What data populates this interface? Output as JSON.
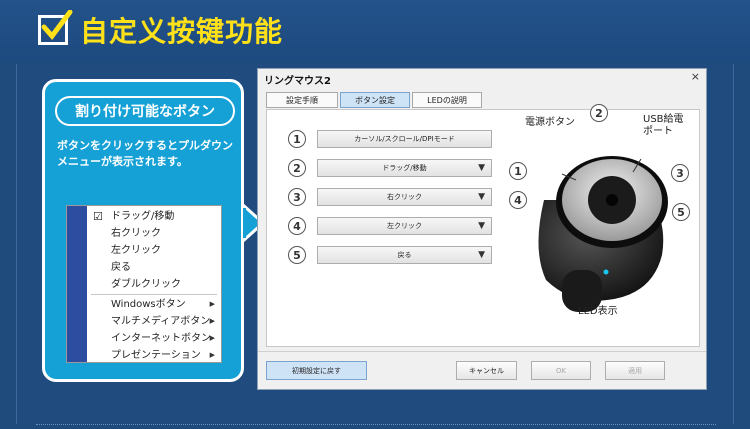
{
  "headline": {
    "title": "自定义按键功能"
  },
  "callout": {
    "pill": "割り付け可能なボタン",
    "description": "ボタンをクリックするとプルダウンメニューが表示されます。",
    "menu": {
      "items": [
        {
          "label": "ドラッグ/移動",
          "checked": true,
          "submenu": false
        },
        {
          "label": "右クリック",
          "checked": false,
          "submenu": false
        },
        {
          "label": "左クリック",
          "checked": false,
          "submenu": false
        },
        {
          "label": "戻る",
          "checked": false,
          "submenu": false
        },
        {
          "label": "ダブルクリック",
          "checked": false,
          "submenu": false
        },
        {
          "label": "Windowsボタン",
          "checked": false,
          "submenu": true
        },
        {
          "label": "マルチメディアボタン",
          "checked": false,
          "submenu": true
        },
        {
          "label": "インターネットボタン",
          "checked": false,
          "submenu": true
        },
        {
          "label": "プレゼンテーション",
          "checked": false,
          "submenu": true
        }
      ]
    }
  },
  "dialog": {
    "title": "リングマウス2",
    "close": "×",
    "tabs": [
      {
        "label": "設定手順",
        "active": false
      },
      {
        "label": "ボタン設定",
        "active": true
      },
      {
        "label": "LEDの説明",
        "active": false
      }
    ],
    "assignments": [
      {
        "num": "1",
        "label": "カーソル/スクロール/DPIモード",
        "dropdown": false
      },
      {
        "num": "2",
        "label": "ドラッグ/移動",
        "dropdown": true
      },
      {
        "num": "3",
        "label": "右クリック",
        "dropdown": true
      },
      {
        "num": "4",
        "label": "左クリック",
        "dropdown": true
      },
      {
        "num": "5",
        "label": "戻る",
        "dropdown": true
      }
    ],
    "diagram": {
      "power_label": "電源ボタン",
      "usb_label_line1": "USB給電",
      "usb_label_line2": "ポート",
      "led_label": "LED表示",
      "numbers": [
        "1",
        "2",
        "3",
        "4",
        "5"
      ]
    },
    "footer": {
      "reset": "初期設定に戻す",
      "cancel": "キャンセル",
      "ok": "OK",
      "apply": "適用"
    }
  },
  "colors": {
    "background": "#1e4a7c",
    "headline": "#ffe11a",
    "callout": "#16a1d6",
    "menu_strip": "#2d4ea0",
    "led": "#19c6f0"
  }
}
